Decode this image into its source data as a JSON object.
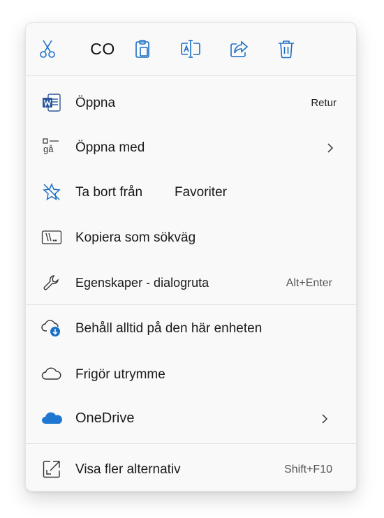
{
  "toolbar": {
    "cut_icon": "scissors-icon",
    "copy_label": "CO",
    "paste_icon": "clipboard-icon",
    "rename_icon": "rename-icon",
    "share_icon": "share-icon",
    "delete_icon": "trash-icon"
  },
  "items": {
    "open": {
      "label": "Öppna",
      "shortcut": "Retur",
      "icon": "word-doc-icon"
    },
    "open_with": {
      "label": "Öppna med",
      "icon": "open-with-icon",
      "icon_text": "gå"
    },
    "remove_favorites": {
      "label": "Ta bort från",
      "label2": "Favoriter",
      "icon": "star-off-icon"
    },
    "copy_path": {
      "label": "Kopiera som sökväg",
      "icon": "copy-path-icon"
    },
    "properties": {
      "label": "Egenskaper - dialogruta",
      "shortcut": "Alt+Enter",
      "icon": "wrench-icon"
    },
    "always_keep": {
      "label": "Behåll alltid på den här enheten",
      "icon": "cloud-download-icon"
    },
    "free_space": {
      "label": "Frigör utrymme",
      "icon": "cloud-icon"
    },
    "onedrive": {
      "label": "OneDrive",
      "icon": "onedrive-icon"
    },
    "more_options": {
      "label": "Visa fler alternativ",
      "shortcut": "Shift+F10",
      "icon": "open-external-icon"
    }
  },
  "colors": {
    "accent": "#1a6fc4",
    "onedrive": "#1e78d2",
    "word": "#2b579a",
    "text": "#1a1a1a",
    "menu_bg": "#f9f9f9"
  }
}
